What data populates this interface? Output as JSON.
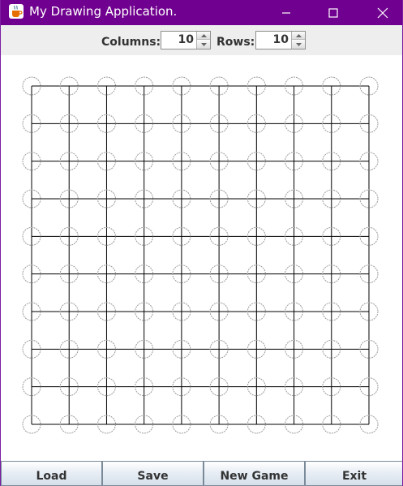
{
  "window": {
    "title": "My Drawing Application.",
    "icon": "java-cup-icon",
    "title_bar_color": "#70008f"
  },
  "controls": {
    "columns_label": "Columns:",
    "columns_value": "10",
    "rows_label": "Rows:",
    "rows_value": "10"
  },
  "grid": {
    "columns": 10,
    "rows": 10,
    "line_color": "#000000",
    "circle_color": "#9a9a9a"
  },
  "buttons": {
    "load": "Load",
    "save": "Save",
    "new_game": "New Game",
    "exit": "Exit"
  }
}
